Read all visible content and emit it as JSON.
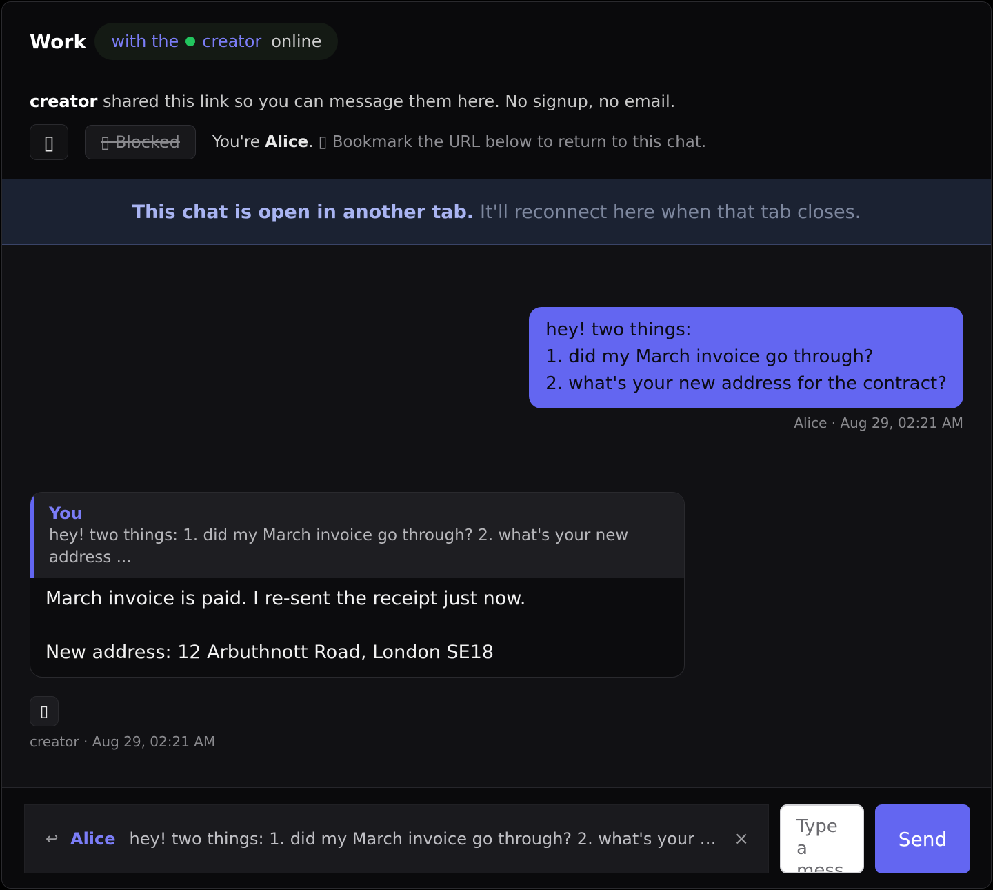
{
  "header": {
    "space_name": "Work",
    "presence": {
      "prefix": "with the",
      "name": "creator",
      "status": "online"
    },
    "share_note": {
      "name": "creator",
      "text": "shared this link so you can message them here. No signup, no email."
    },
    "controls": {
      "settings_icon": "box-glyph-icon",
      "settings_glyph": "▯",
      "blocked_label": "▯ Blocked"
    },
    "identity": {
      "prefix": "You're",
      "name": "Alice",
      "suffix": ".",
      "bookmark_glyph": "▯",
      "bookmark_text": "Bookmark the URL below to return to this chat."
    }
  },
  "banner": {
    "bold": "This chat is open in another tab.",
    "rest": "It'll reconnect here when that tab closes."
  },
  "messages": [
    {
      "direction": "outgoing",
      "lines": [
        "hey! two things:",
        "1. did my March invoice go through?",
        "2. what's your new address for the contract?"
      ],
      "meta": "Alice · Aug 29, 02:21 AM"
    },
    {
      "direction": "incoming",
      "quote": {
        "author": "You",
        "text": "hey! two things: 1. did my March invoice go through? 2. what's your new address ..."
      },
      "lines": [
        "March invoice is paid. I re-sent the receipt just now.",
        "New address: 12 Arbuthnott Road, London SE18"
      ],
      "reaction_glyph": "▯",
      "meta": "creator · Aug 29, 02:21 AM"
    }
  ],
  "composer": {
    "reply": {
      "icon": "↩",
      "author": "Alice",
      "text": "hey! two things: 1. did my March invoice go through? 2. what's your new address for the contract?",
      "close": "×"
    },
    "input_placeholder": "Type a message",
    "send_label": "Send"
  },
  "colors": {
    "accent": "#6366f1",
    "online": "#22c55e",
    "banner_bg": "#1b2232"
  }
}
